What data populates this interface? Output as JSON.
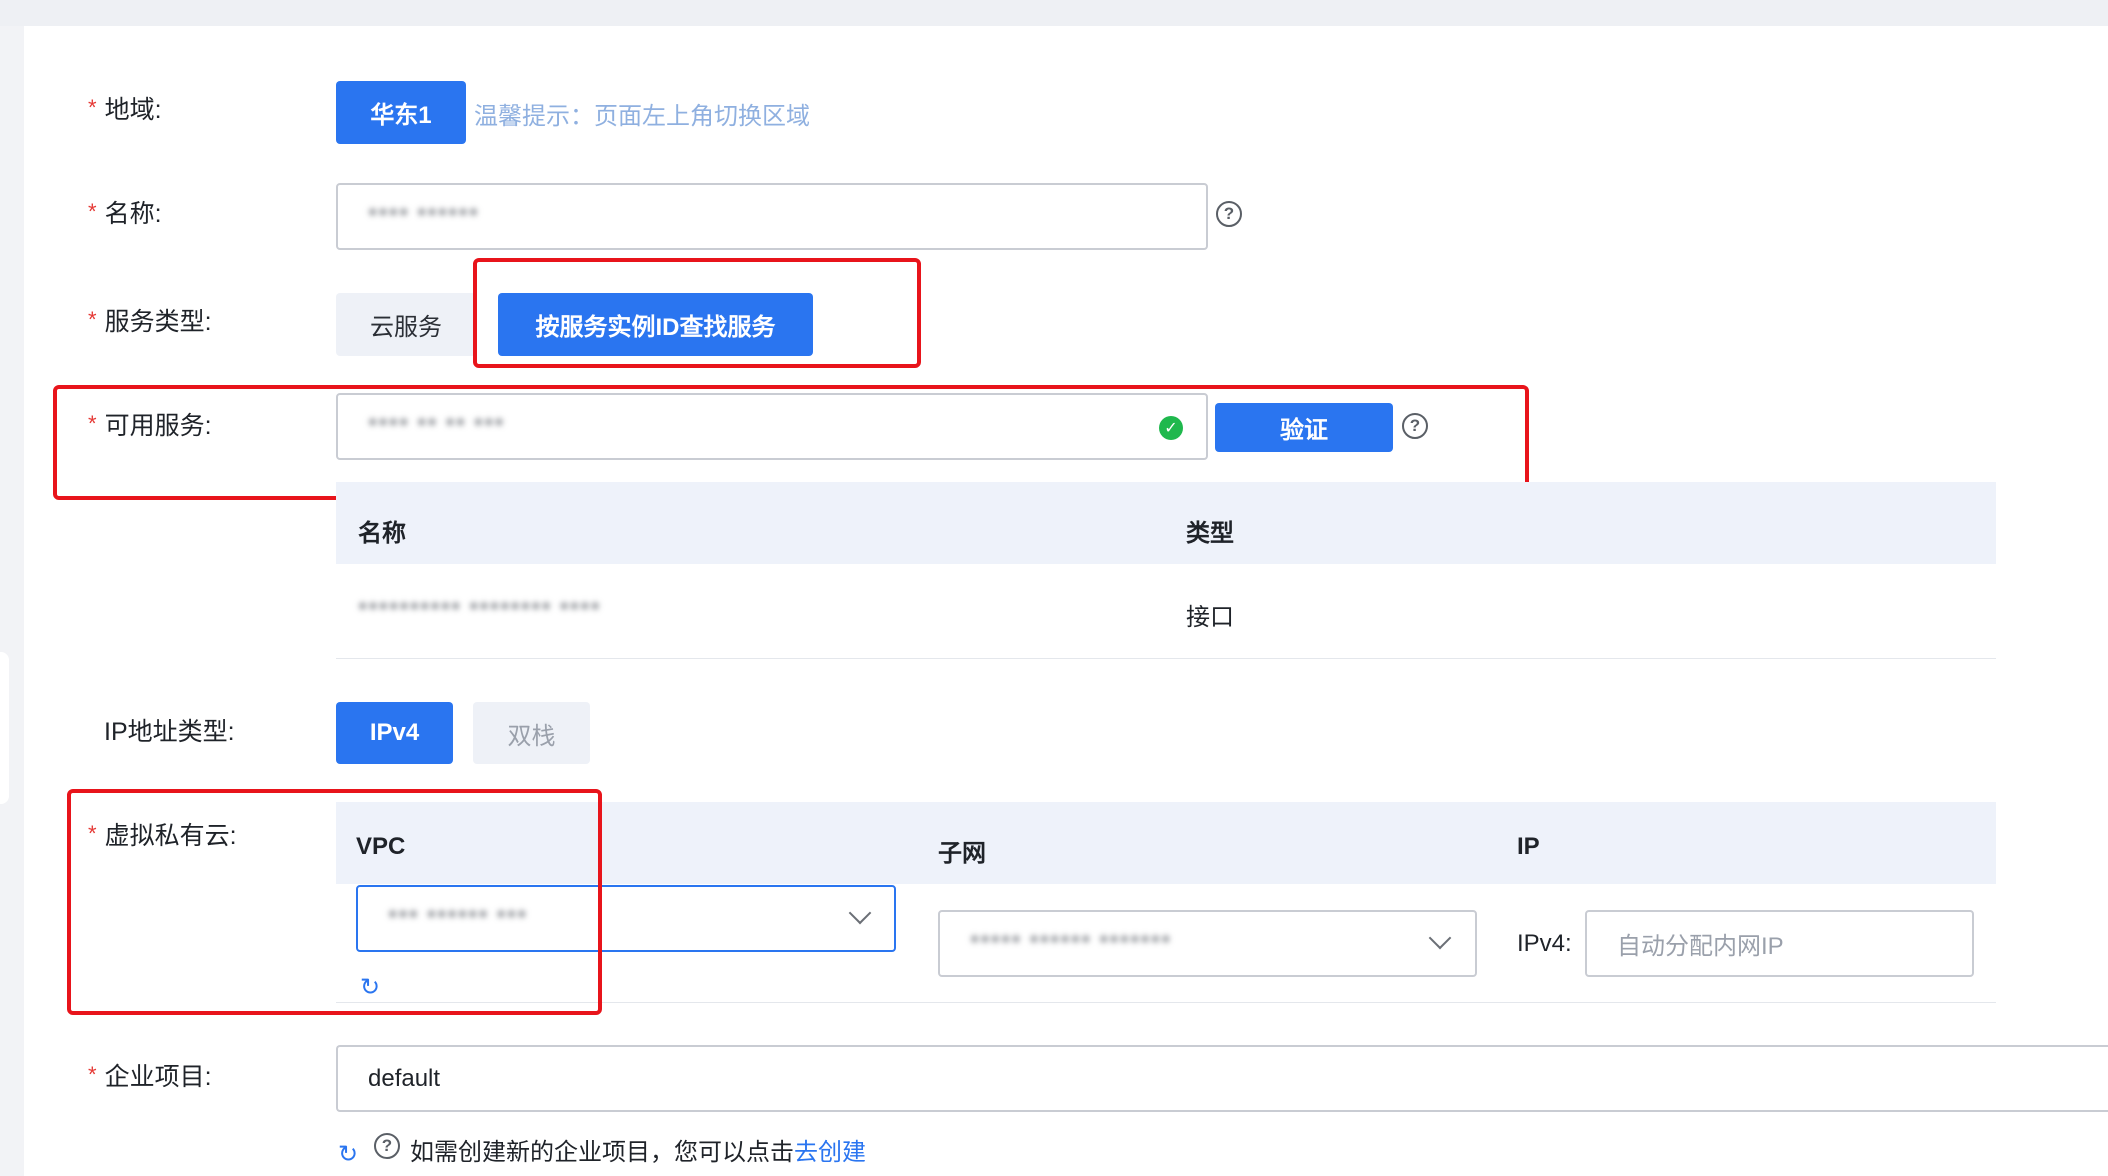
{
  "colors": {
    "primary": "#2a75f0",
    "highlight_box": "#e8141b",
    "success": "#1fb84d",
    "hint": "#8fb0e0"
  },
  "region": {
    "label": "地域:",
    "value": "华东1",
    "hint": "温馨提示：页面左上角切换区域"
  },
  "name": {
    "label": "名称:",
    "value": "**** ******",
    "help_icon": "question-circle-icon"
  },
  "service_type": {
    "label": "服务类型:",
    "options": [
      "云服务",
      "按服务实例ID查找服务"
    ],
    "selected": "按服务实例ID查找服务"
  },
  "available_service": {
    "label": "可用服务:",
    "value": "**** ** ** ***",
    "status_icon": "check-circle-icon",
    "verify_button": "验证",
    "help_icon": "question-circle-icon"
  },
  "service_table": {
    "headers": [
      "名称",
      "类型"
    ],
    "rows": [
      {
        "name": "********** ******** ****",
        "type": "接口"
      }
    ]
  },
  "ip_type": {
    "label": "IP地址类型:",
    "options": [
      "IPv4",
      "双栈"
    ],
    "selected": "IPv4"
  },
  "vpc": {
    "label": "虚拟私有云:",
    "headers": [
      "VPC",
      "子网",
      "IP"
    ],
    "vpc_value": "*** ****** ***",
    "subnet_value": "***** ****** *******",
    "ip_label": "IPv4:",
    "ip_placeholder": "自动分配内网IP",
    "refresh_icon": "refresh-icon"
  },
  "enterprise_project": {
    "label": "企业项目:",
    "value": "default",
    "tip_text": "如需创建新的企业项目，您可以点击",
    "tip_link": "去创建"
  },
  "required_mark": "*"
}
